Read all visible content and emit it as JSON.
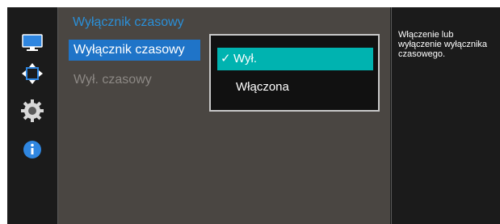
{
  "menu": {
    "title": "Wyłącznik czasowy",
    "items": [
      {
        "label": "Wyłącznik czasowy",
        "selected": true
      },
      {
        "label": "Wył. czasowy",
        "selected": false
      }
    ]
  },
  "dropdown": {
    "options": [
      {
        "label": "Wył.",
        "checked": true
      },
      {
        "label": "Włączona",
        "checked": false
      }
    ],
    "check_glyph": "✓"
  },
  "help": {
    "text": "Włączenie lub\nwyłączenie wyłącznika\nczasowego."
  },
  "nav_icons": [
    "monitor-icon",
    "resize-arrows-icon",
    "gear-icon",
    "info-icon"
  ],
  "colors": {
    "selected_item": "#1f74c8",
    "active_option": "#00b3b0",
    "title": "#2a8fd8",
    "panel": "#4a4642"
  }
}
